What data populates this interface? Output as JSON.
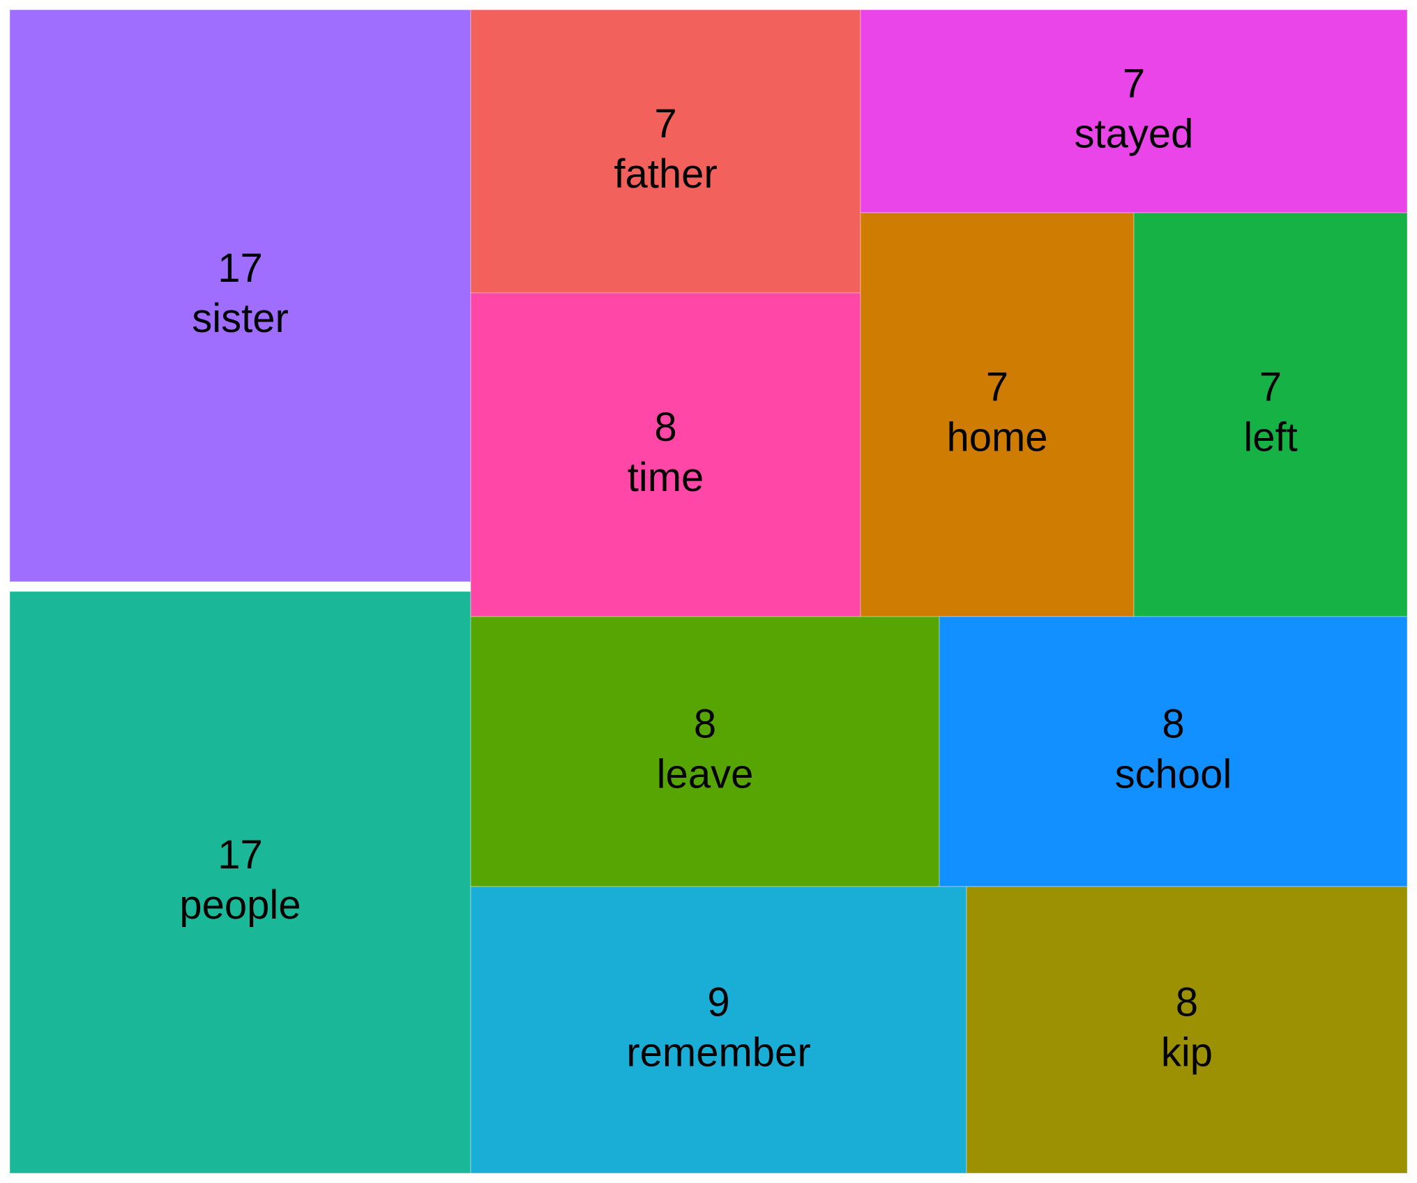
{
  "chart_data": {
    "type": "treemap",
    "value_labels_shown": true,
    "tiles": [
      {
        "label": "sister",
        "value": 17,
        "value_text": "17",
        "color": "#A06EFF"
      },
      {
        "label": "people",
        "value": 17,
        "value_text": "17",
        "color": "#1AB898"
      },
      {
        "label": "father",
        "value": 7,
        "value_text": "7",
        "color": "#F2615B"
      },
      {
        "label": "time",
        "value": 8,
        "value_text": "8",
        "color": "#FF47A8"
      },
      {
        "label": "stayed",
        "value": 7,
        "value_text": "7",
        "color": "#E945E9"
      },
      {
        "label": "home",
        "value": 7,
        "value_text": "7",
        "color": "#CF7C03"
      },
      {
        "label": "left",
        "value": 7,
        "value_text": "7",
        "color": "#17B245"
      },
      {
        "label": "leave",
        "value": 8,
        "value_text": "8",
        "color": "#56A502"
      },
      {
        "label": "school",
        "value": 8,
        "value_text": "8",
        "color": "#1290FF"
      },
      {
        "label": "remember",
        "value": 9,
        "value_text": "9",
        "color": "#1AADD6"
      },
      {
        "label": "kip",
        "value": 8,
        "value_text": "8",
        "color": "#9C9102"
      }
    ]
  }
}
